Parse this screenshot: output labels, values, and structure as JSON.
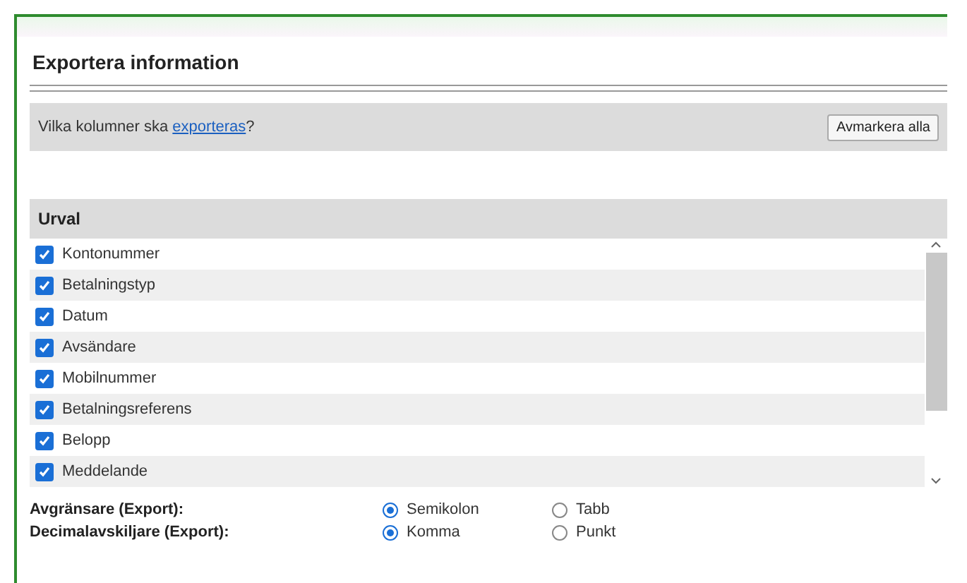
{
  "title": "Exportera information",
  "question": {
    "before": "Vilka kolumner ska ",
    "link": "exporteras",
    "after": "?"
  },
  "deselect_button": "Avmarkera alla",
  "selection": {
    "header": "Urval",
    "items": [
      {
        "label": "Kontonummer",
        "checked": true
      },
      {
        "label": "Betalningstyp",
        "checked": true
      },
      {
        "label": "Datum",
        "checked": true
      },
      {
        "label": "Avsändare",
        "checked": true
      },
      {
        "label": "Mobilnummer",
        "checked": true
      },
      {
        "label": "Betalningsreferens",
        "checked": true
      },
      {
        "label": "Belopp",
        "checked": true
      },
      {
        "label": "Meddelande",
        "checked": true
      }
    ]
  },
  "options": [
    {
      "label": "Avgränsare (Export):",
      "choices": [
        {
          "label": "Semikolon",
          "selected": true
        },
        {
          "label": "Tabb",
          "selected": false
        }
      ]
    },
    {
      "label": "Decimalavskiljare (Export):",
      "choices": [
        {
          "label": "Komma",
          "selected": true
        },
        {
          "label": "Punkt",
          "selected": false
        }
      ]
    }
  ]
}
